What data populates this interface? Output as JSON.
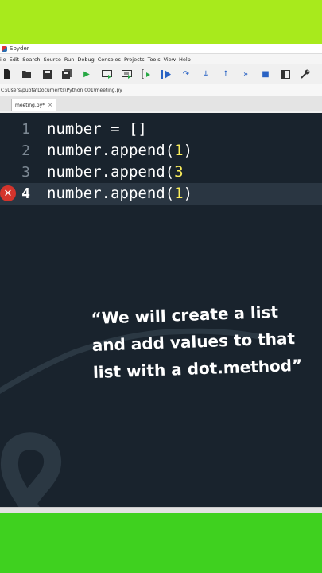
{
  "app": {
    "title": "Spyder",
    "menu": [
      "ile",
      "Edit",
      "Search",
      "Source",
      "Run",
      "Debug",
      "Consoles",
      "Projects",
      "Tools",
      "View",
      "Help"
    ],
    "toolbar_icons": [
      "new-file-icon",
      "open-folder-icon",
      "save-icon",
      "save-all-icon",
      "run-icon",
      "run-cell-icon",
      "run-cell-advance-icon",
      "run-selection-icon",
      "debug-icon",
      "step-over-icon",
      "step-into-icon",
      "step-return-icon",
      "continue-icon",
      "stop-icon",
      "maximize-pane-icon",
      "wrench-icon"
    ],
    "path": "C:\\Users\\pubfa\\Documents\\Python 001\\meeting.py",
    "tab": {
      "label": "meeting.py*",
      "close": "×"
    }
  },
  "editor": {
    "lines": [
      {
        "num": "1",
        "pre": "number = []",
        "val": "",
        "post": ""
      },
      {
        "num": "2",
        "pre": "number.append(",
        "val": "1",
        "post": ")"
      },
      {
        "num": "3",
        "pre": "number.append(",
        "val": "3",
        "post": ""
      },
      {
        "num": "4",
        "pre": "number.append(",
        "val": "1",
        "post": ")"
      }
    ],
    "error_line": "4"
  },
  "caption": "“We will create a list and add values to that list with a dot.method”",
  "colors": {
    "editor_bg": "#19232d",
    "number": "#faed5c",
    "error": "#d4342c",
    "band_top": "#a8ea1c",
    "band_bottom": "#3fd11f"
  }
}
